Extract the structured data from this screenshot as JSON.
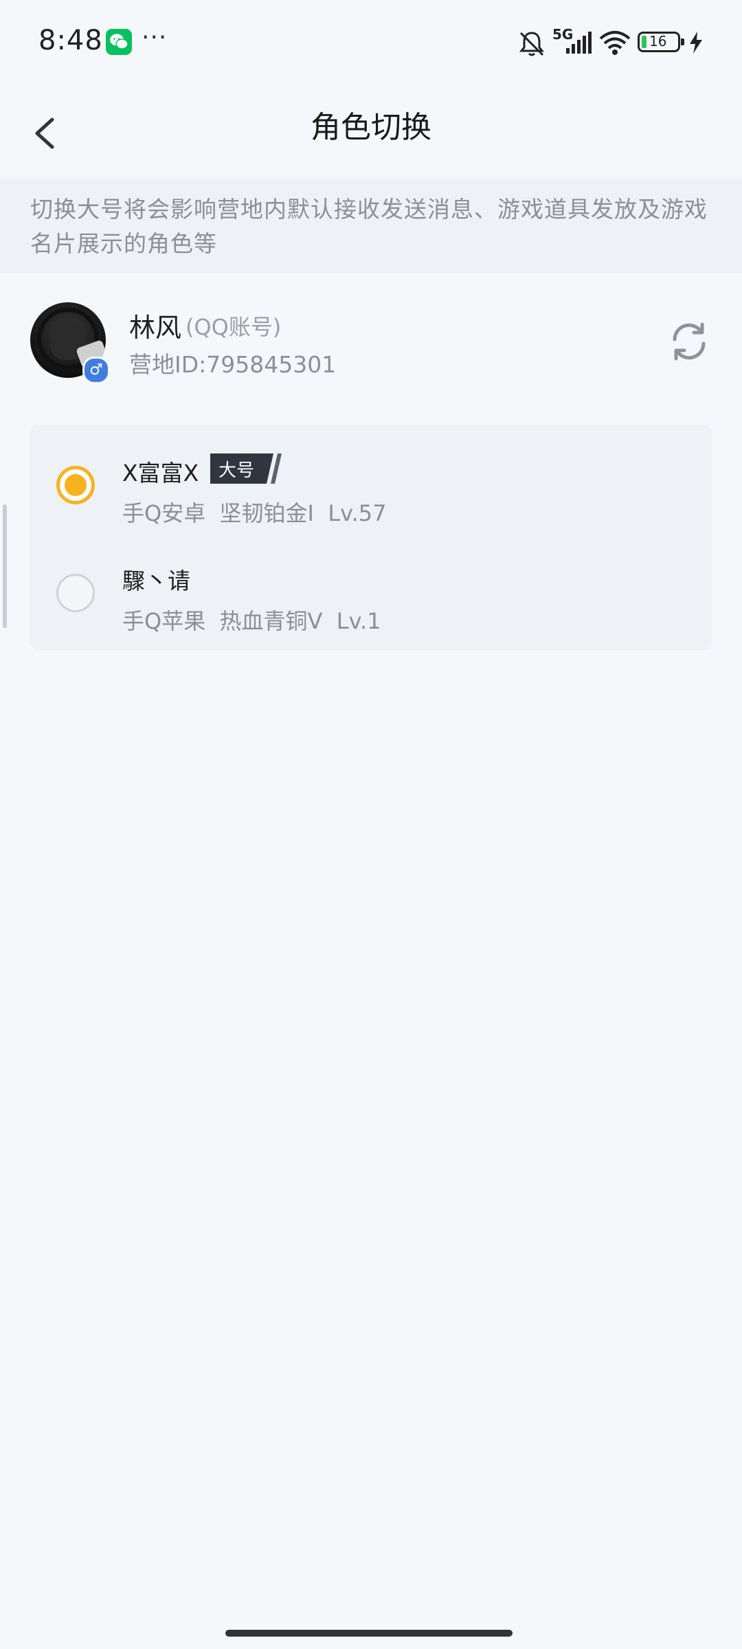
{
  "status_bar": {
    "time": "8:48",
    "network": "5G",
    "battery": "16",
    "icons": [
      "wechat-icon",
      "more-dots-icon",
      "mute-bell-icon",
      "signal-icon",
      "wifi-icon",
      "battery-icon",
      "charging-icon"
    ],
    "more": "···"
  },
  "nav": {
    "title": "角色切换",
    "back_icon": "back-arrow-icon"
  },
  "notice": {
    "text": "切换大号将会影响营地内默认接收发送消息、游戏道具发放及游戏名片展示的角色等"
  },
  "account": {
    "name": "林风",
    "type": "(QQ账号)",
    "camp_id": "营地ID:795845301",
    "gender_symbol": "♂",
    "refresh_icon": "refresh-icon"
  },
  "roles": [
    {
      "name": "X富富X",
      "tag": "大号",
      "info": "手Q安卓  坚韧铂金I  Lv.57",
      "selected": true
    },
    {
      "name": "驟丶请",
      "info": "手Q苹果  热血青铜V  Lv.1",
      "selected": false
    }
  ],
  "colors": {
    "background": "#f5f8fb",
    "accent": "#f7b21f",
    "muted_text": "#8b8f96",
    "tag_bg": "#2f3640"
  }
}
